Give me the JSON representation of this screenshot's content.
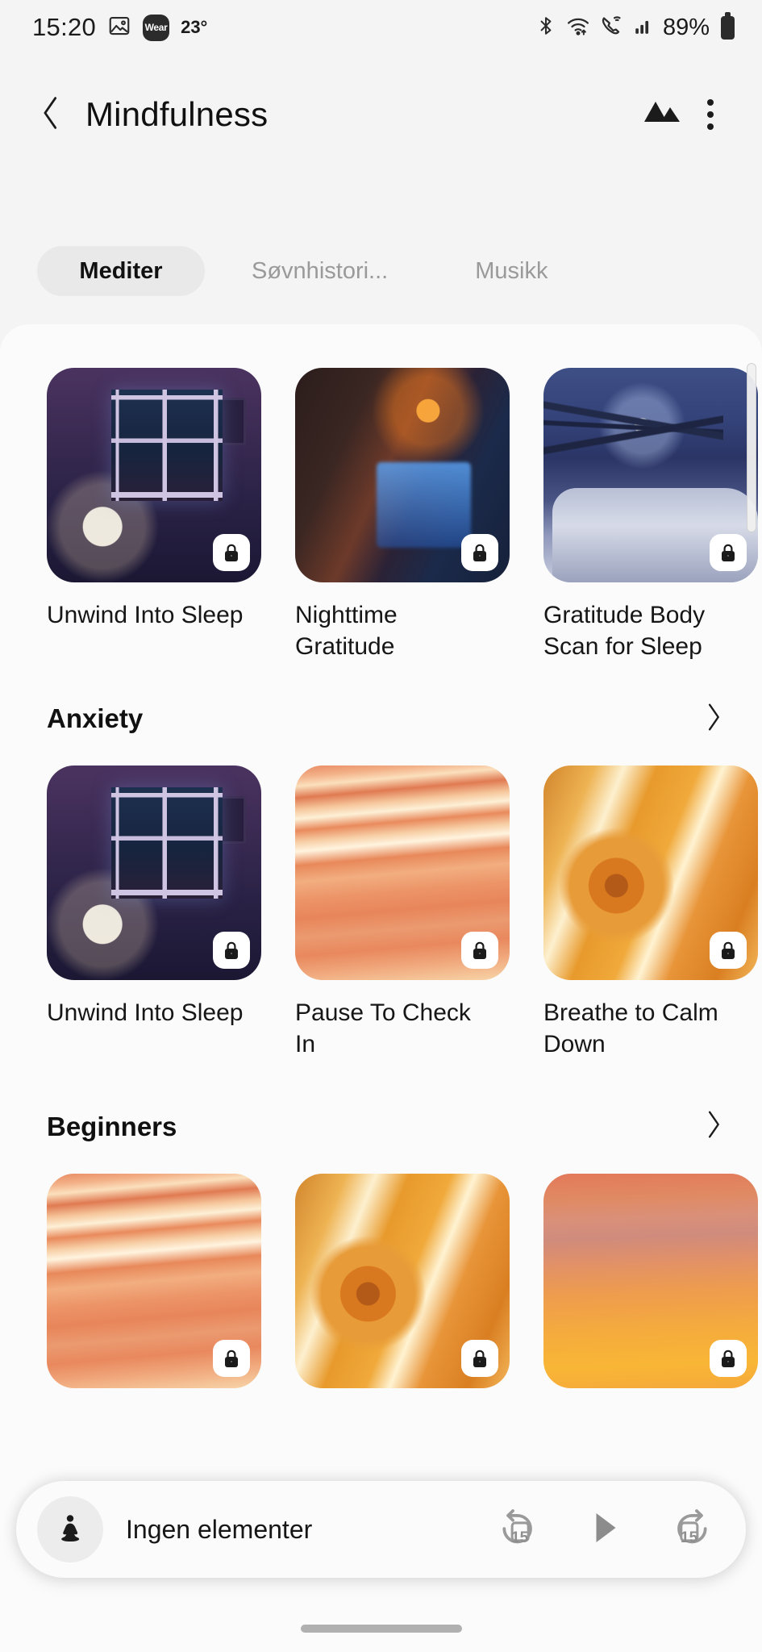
{
  "statusbar": {
    "time": "15:20",
    "gallery_icon": "image-icon",
    "wear_badge_label": "Wear",
    "temperature": "23°",
    "bluetooth_icon": "bluetooth-icon",
    "wifi_icon": "wifi-icon",
    "call_icon": "wifi-calling-icon",
    "signal_icon": "cellular-signal-icon",
    "battery": "89%"
  },
  "header": {
    "back_icon": "back-chevron-icon",
    "title": "Mindfulness",
    "mountain_icon": "mountain-icon",
    "overflow_icon": "more-options-icon"
  },
  "tabs": [
    {
      "label": "Mediter",
      "active": true
    },
    {
      "label": "Søvnhistori...",
      "active": false
    },
    {
      "label": "Musikk",
      "active": false
    }
  ],
  "sections": [
    {
      "title": "",
      "has_header": false,
      "chevron_icon": "chevron-right-icon",
      "cards": [
        {
          "title": "Unwind Into Sleep",
          "art": "art-bedroom-window",
          "locked": true,
          "lock_icon": "lock-icon"
        },
        {
          "title": "Nighttime Gratitude",
          "art": "art-attic",
          "locked": true,
          "lock_icon": "lock-icon"
        },
        {
          "title": "Gratitude Body Scan for Sleep",
          "art": "art-winter-bed",
          "locked": true,
          "lock_icon": "lock-icon"
        }
      ]
    },
    {
      "title": "Anxiety",
      "has_header": true,
      "chevron_icon": "chevron-right-icon",
      "cards": [
        {
          "title": "Unwind Into Sleep",
          "art": "art-bedroom-window",
          "locked": true,
          "lock_icon": "lock-icon"
        },
        {
          "title": "Pause To Check In",
          "art": "art-agate",
          "locked": true,
          "lock_icon": "lock-icon"
        },
        {
          "title": "Breathe to Calm Down",
          "art": "art-rose",
          "locked": true,
          "lock_icon": "lock-icon"
        }
      ]
    },
    {
      "title": "Beginners",
      "has_header": true,
      "chevron_icon": "chevron-right-icon",
      "cards": [
        {
          "title": "",
          "art": "art-agate",
          "locked": true,
          "lock_icon": "lock-icon"
        },
        {
          "title": "",
          "art": "art-rose",
          "locked": true,
          "lock_icon": "lock-icon"
        },
        {
          "title": "",
          "art": "art-sky",
          "locked": true,
          "lock_icon": "lock-icon"
        }
      ]
    }
  ],
  "player": {
    "avatar_icon": "meditation-person-icon",
    "title": "Ingen elementer",
    "rewind_label": "15",
    "rewind_icon": "rewind-15-icon",
    "play_icon": "play-icon",
    "forward_label": "15",
    "forward_icon": "forward-15-icon"
  },
  "colors": {
    "background": "#f4f4f4",
    "sheet": "#fbfbfb",
    "text_primary": "#111111",
    "text_muted": "#9a9a9a",
    "tab_active_bg": "#e9e9e9"
  }
}
